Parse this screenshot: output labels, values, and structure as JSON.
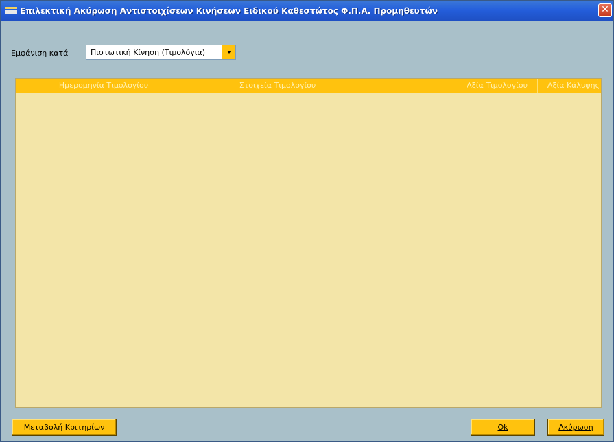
{
  "window": {
    "title": "Επιλεκτική Ακύρωση Αντιστοιχίσεων Κινήσεων Ειδικού Καθεστώτος Φ.Π.Α. Προμηθευτών",
    "close_glyph": "✕"
  },
  "filter": {
    "label": "Εμφάνιση κατά",
    "selected": "Πιστωτική Κίνηση (Τιμολόγια)"
  },
  "grid": {
    "columns": [
      "Ημερομηνία Τιμολογίου",
      "Στοιχεία Τιμολογίου",
      "Αξία Τιμολογίου",
      "Αξία Κάλυψης"
    ],
    "rows": []
  },
  "buttons": {
    "criteria": "Μεταβολή Κριτηρίων",
    "ok": "Ok",
    "cancel": "Ακύρωση"
  },
  "colors": {
    "accent": "#ffc20e",
    "background": "#a9c0c9",
    "grid_body": "#f3e5a8",
    "titlebar": "#245edb"
  }
}
